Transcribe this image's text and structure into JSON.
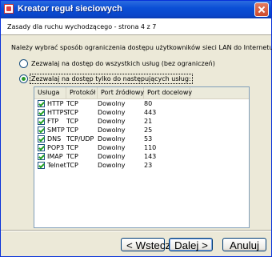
{
  "window": {
    "title": "Kreator reguł sieciowych"
  },
  "header": {
    "title": "Zasady dla ruchu wychodzącego - strona 4 z 7"
  },
  "instruction": "Należy wybrać sposób ograniczenia dostępu użytkowników sieci LAN do Internetu:",
  "options": [
    {
      "label": "Zezwalaj na dostęp do wszystkich usług (bez ograniczeń)",
      "selected": false
    },
    {
      "label": "Zezwalaj na dostęp tylko do następujących usług:",
      "selected": true
    }
  ],
  "table": {
    "columns": [
      "Usługa",
      "Protokół",
      "Port źródłowy",
      "Port docelowy"
    ],
    "rows": [
      {
        "checked": true,
        "service": "HTTP",
        "protocol": "TCP",
        "source": "Dowolny",
        "dest": "80"
      },
      {
        "checked": true,
        "service": "HTTPS",
        "protocol": "TCP",
        "source": "Dowolny",
        "dest": "443"
      },
      {
        "checked": true,
        "service": "FTP",
        "protocol": "TCP",
        "source": "Dowolny",
        "dest": "21"
      },
      {
        "checked": true,
        "service": "SMTP",
        "protocol": "TCP",
        "source": "Dowolny",
        "dest": "25"
      },
      {
        "checked": true,
        "service": "DNS",
        "protocol": "TCP/UDP",
        "source": "Dowolny",
        "dest": "53"
      },
      {
        "checked": true,
        "service": "POP3",
        "protocol": "TCP",
        "source": "Dowolny",
        "dest": "110"
      },
      {
        "checked": true,
        "service": "IMAP",
        "protocol": "TCP",
        "source": "Dowolny",
        "dest": "143"
      },
      {
        "checked": true,
        "service": "Telnet",
        "protocol": "TCP",
        "source": "Dowolny",
        "dest": "23"
      }
    ]
  },
  "buttons": {
    "back": "< Wstecz",
    "next": "Dalej >",
    "cancel": "Anuluj"
  },
  "colors": {
    "titlebar": "#0b4fd6",
    "dialog": "#ece9d8",
    "check": "#21a121"
  },
  "icons": {
    "title": "app-icon",
    "close": "close-icon"
  }
}
